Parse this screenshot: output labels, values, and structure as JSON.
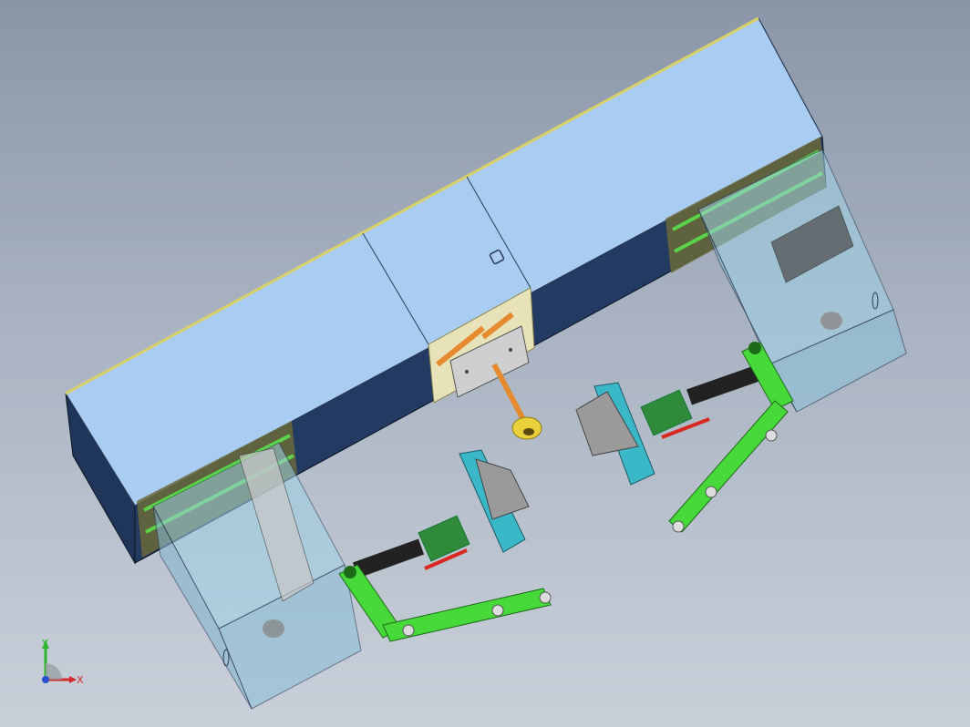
{
  "viewport": {
    "background_top": "#8a96a8",
    "background_bottom": "#c9d0da"
  },
  "model": {
    "colors": {
      "enclosure_top": "#a9ccf3",
      "enclosure_side": "#1f3559",
      "frame_yellow": "#d8d16a",
      "frame_green": "#5ad24a",
      "guard_glass": "#9fd3e6",
      "arm_green": "#47d83a",
      "gripper_cyan": "#3ab8c8",
      "leadscrew_orange": "#e58a2e",
      "coupling_yellow": "#e8d13a",
      "handle_red": "#d8281f"
    }
  },
  "triad": {
    "y_label": "Y",
    "x_label": "X",
    "y_color": "#2fb52f",
    "x_color": "#d12a2a",
    "z_color": "#2a4fd1"
  }
}
